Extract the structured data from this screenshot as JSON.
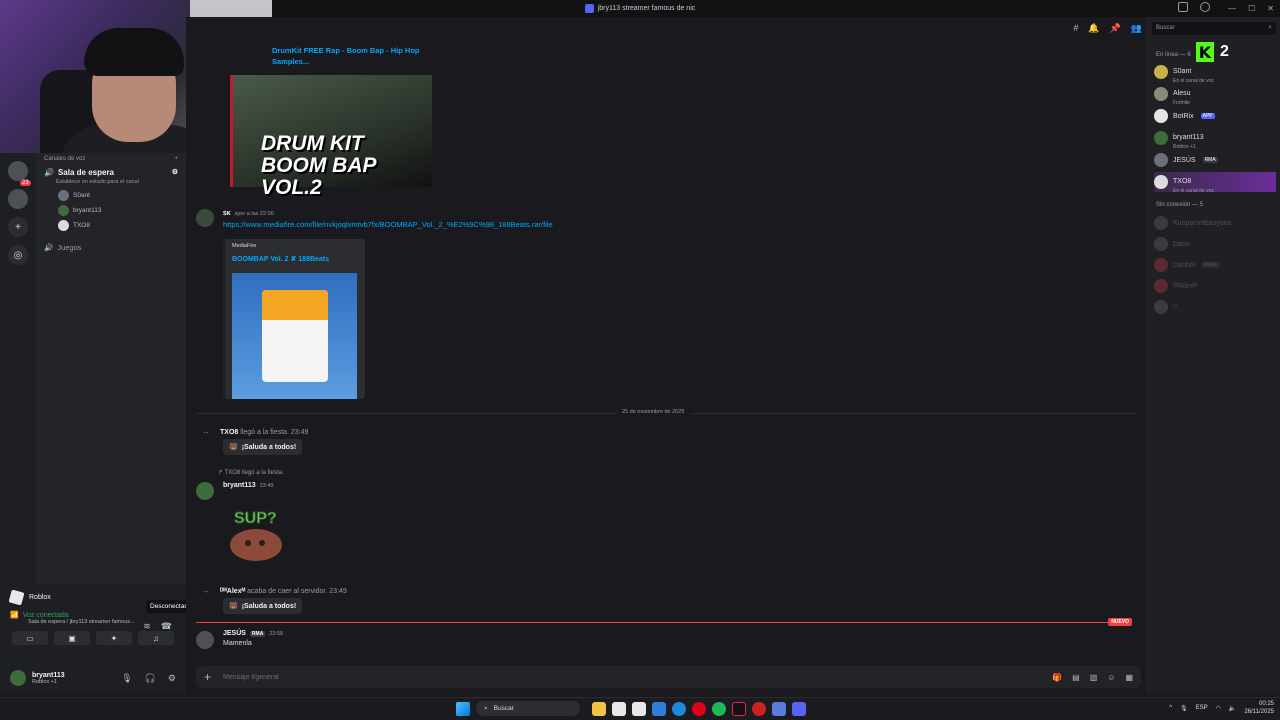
{
  "window": {
    "title": "jbry113 streamer famous de nic"
  },
  "channels": {
    "category": "Canales de voz",
    "voice_channel": "Sala de espera",
    "voice_status": "Establece un estado para el canal",
    "members": [
      "S0ant",
      "bryant113",
      "TXO8"
    ],
    "other_channel": "Juegos"
  },
  "rail": {
    "badge": "23"
  },
  "activity": {
    "game": "Roblox",
    "tooltip": "Desconectar"
  },
  "voice": {
    "status": "Voz conectada",
    "path": "Sala de espera / jbry113 streamer famous..."
  },
  "me": {
    "name": "bryant113",
    "sub": "Roblox +1"
  },
  "chat": {
    "embed1_title": "DrumKit FREE Rap - Boom Bap - Hip Hop Samples...",
    "embed1_caption": "DRUM KIT BOOM BAP VOL.2",
    "msg1": {
      "author": "ꜱᴋ",
      "time": "ayer a las 22:00",
      "link": "https://www.mediafire.com/file/nvkjoqlxmtvb7fx/BOOMBAP_Vol._2_%E2%9C%98_188Beats.rar/file"
    },
    "mf": {
      "provider": "MediaFire",
      "title": "BOOMBAP Vol. 2 ✘ 188Beats"
    },
    "date_divider": "25 de noviembre de 2025",
    "join1": {
      "name": "TXO8",
      "text": "llegó a la fiesta.",
      "time": "23:49"
    },
    "wave_label": "¡Saluda a todos!",
    "reply": "TXO8 llegó a la fiesta.",
    "msg2": {
      "author": "bryant113",
      "time": "23:49"
    },
    "sticker_text": "SUP?",
    "join2": {
      "name": "ᴰᴹAlexᴹ",
      "text": "acaba de caer al servidor.",
      "time": "23:49"
    },
    "new_badge": "NUEVO",
    "msg3": {
      "author": "JESÚS",
      "tag": "RMA",
      "time": "23:58",
      "text": "Mamenla"
    },
    "composer_placeholder": "Mensaje #general"
  },
  "members": {
    "search_placeholder": "Buscar",
    "online_header": "En línea — 6",
    "kick_count": "2",
    "online": [
      {
        "name": "S0ant",
        "sub": "En el canal de voz"
      },
      {
        "name": "Alesu",
        "sub": "Fortnite"
      },
      {
        "name": "BotRix",
        "sub": ""
      },
      {
        "name": "bryant113",
        "sub": "Roblox +1"
      },
      {
        "name": "JESÚS",
        "sub": ""
      },
      {
        "name": "TXO8",
        "sub": "En el canal de voz"
      }
    ],
    "offline_header": "Sin conexión — 5",
    "offline": [
      "Kunpamntbasyuna",
      "Dario",
      "Danbel",
      "ᴰᴹAlexᴹ",
      "ᵐ"
    ],
    "botrix_tag": "APP",
    "jesus_tag": "RMA",
    "danbel_tag": "FRAK"
  },
  "taskbar": {
    "search": "Buscar",
    "lang": "ESP",
    "time": "00:25",
    "date": "26/11/2025"
  }
}
